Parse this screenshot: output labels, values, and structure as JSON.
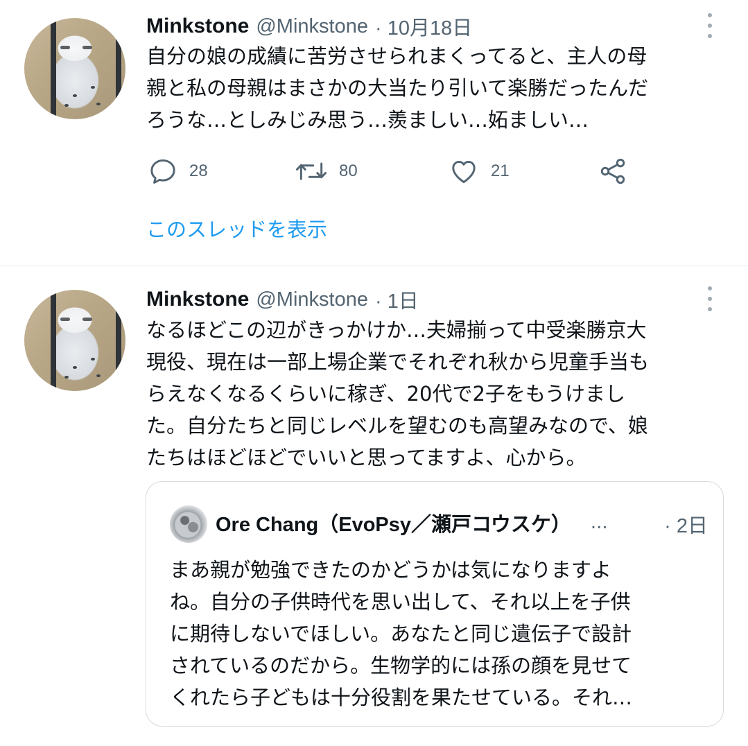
{
  "tweets": [
    {
      "display_name": "Minkstone",
      "handle": "@Minkstone",
      "time": "· 10月18日",
      "text": "自分の娘の成績に苦労させられまくってると、主人の母\n親と私の母親はまさかの大当たり引いて楽勝だったんだ\nろうな…としみじみ思う…羨ましい…妬ましい…",
      "reply_count": "28",
      "retweet_count": "80",
      "like_count": "21",
      "show_thread": "このスレッドを表示"
    },
    {
      "display_name": "Minkstone",
      "handle": "@Minkstone",
      "time": "· 1日",
      "text": "なるほどこの辺がきっかけか…夫婦揃って中受楽勝京大\n現役、現在は一部上場企業でそれぞれ秋から児童手当も\nらえなくなるくらいに稼ぎ、20代で2子をもうけまし\nた。自分たちと同じレベルを望むのも高望みなので、娘\nたちはほどほどでいいと思ってますよ、心から。",
      "quote": {
        "display_name": "Ore Chang（EvoPsy／瀬戸コウスケ）",
        "ellipsis": "...",
        "time": "· 2日",
        "text": "まあ親が勉強できたのかどうかは気になりますよ\nね。自分の子供時代を思い出して、それ以上を子供\nに期待しないでほしい。あなたと同じ遺伝子で設計\nされているのだから。生物学的には孫の顔を見せて\nくれたら子どもは十分役割を果たせている。それ…"
      }
    }
  ],
  "icons": {
    "reply": "reply-icon",
    "retweet": "retweet-icon",
    "like": "like-icon",
    "share": "share-icon",
    "more": "more-options-icon"
  },
  "colors": {
    "accent": "#1d9bf0",
    "secondary_text": "#536471",
    "primary_text": "#0f1419",
    "border": "#d4dade"
  }
}
